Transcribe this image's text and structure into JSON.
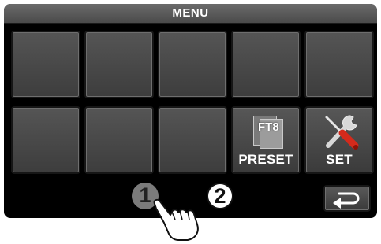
{
  "window": {
    "title": "MENU"
  },
  "menu": {
    "row1": [
      "",
      "",
      "",
      "",
      ""
    ],
    "row2": [
      {
        "label": "",
        "icon": ""
      },
      {
        "label": "",
        "icon": ""
      },
      {
        "label": "",
        "icon": ""
      },
      {
        "label": "PRESET",
        "icon": "ft8-preset-icon",
        "icon_text": "FT8"
      },
      {
        "label": "SET",
        "icon": "tools-icon"
      }
    ]
  },
  "back_button": {
    "icon": "return-arrow-icon"
  },
  "callouts": {
    "one": "1",
    "two": "2"
  },
  "colors": {
    "screen": "#000000",
    "key": "#4a4a4a",
    "titlebar": "#5a5a5a",
    "tool_handle": "#d42a1c"
  }
}
